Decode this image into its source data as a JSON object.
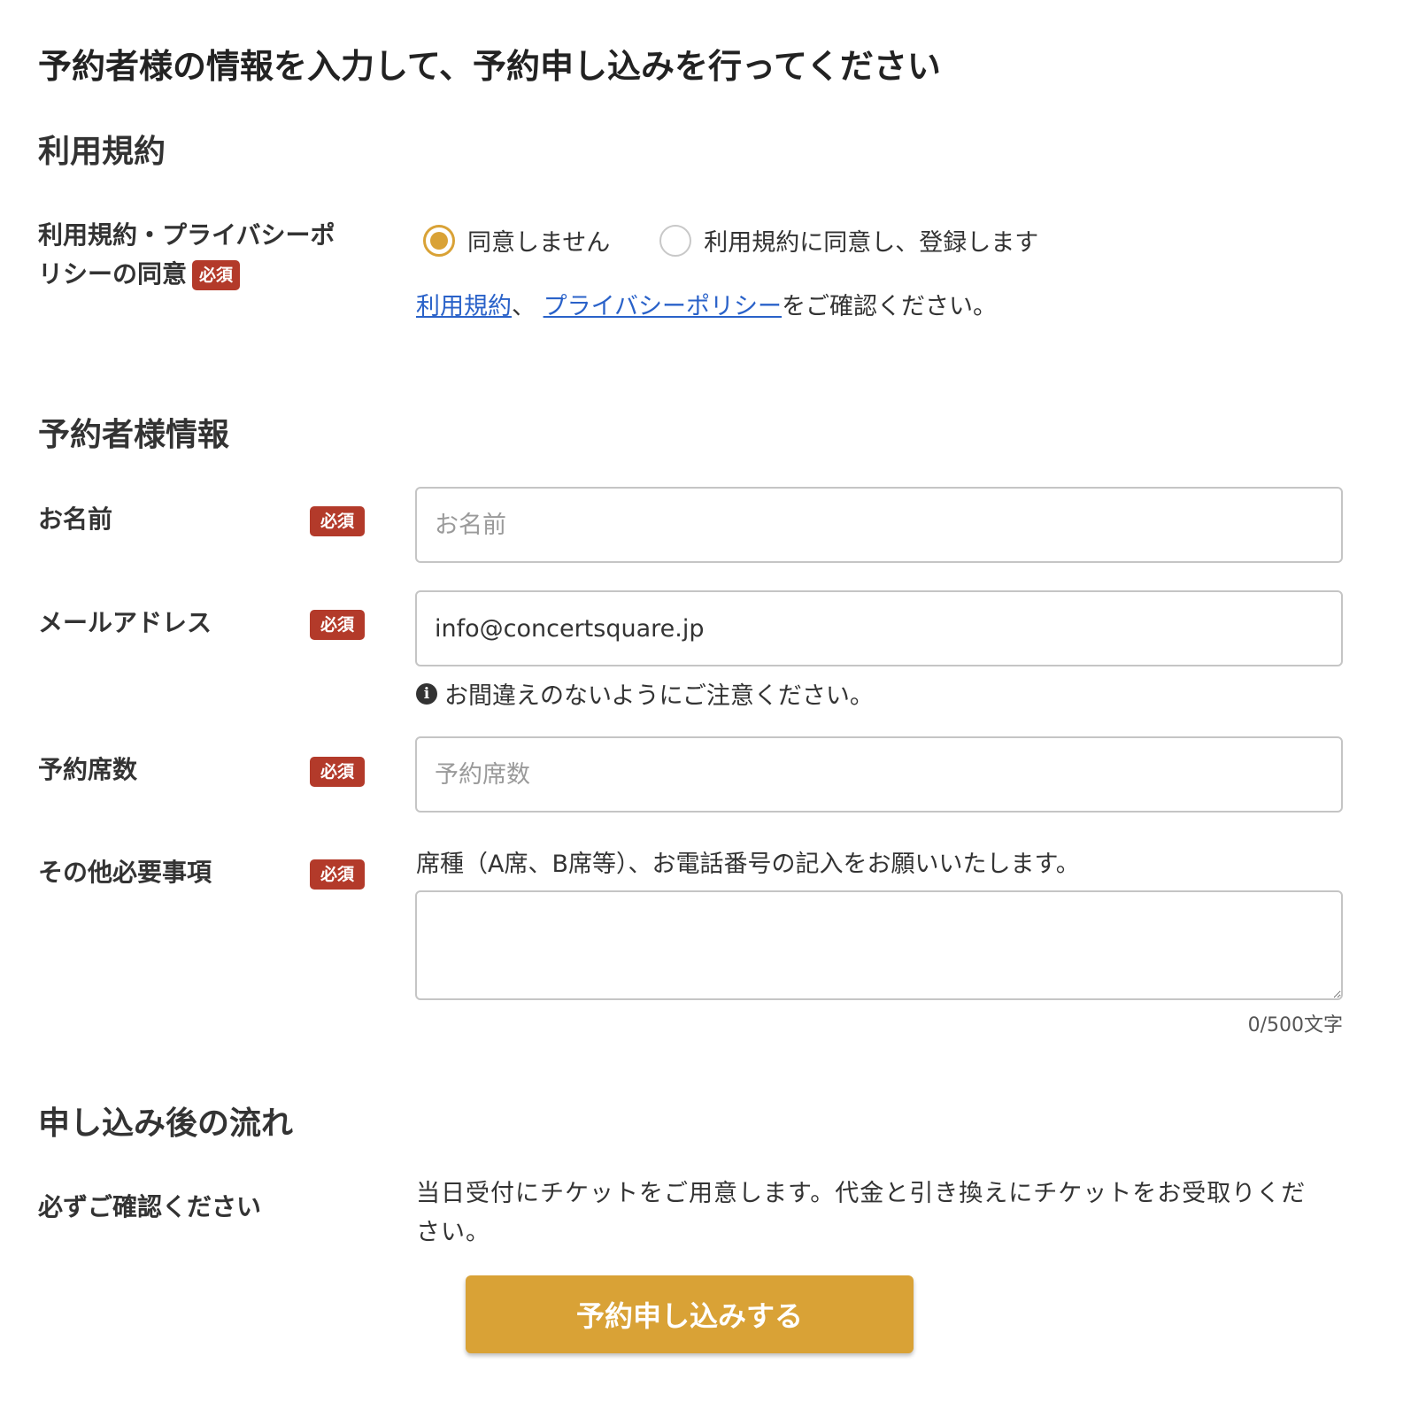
{
  "page": {
    "title": "予約者様の情報を入力して、予約申し込みを行ってください"
  },
  "terms": {
    "section_title": "利用規約",
    "label": "利用規約・プライバシーポリシーの同意",
    "required": "必須",
    "options": [
      {
        "label": "同意しません",
        "selected": true
      },
      {
        "label": "利用規約に同意し、登録します",
        "selected": false
      }
    ],
    "note_link_terms": "利用規約",
    "note_sep": "、 ",
    "note_link_privacy": "プライバシーポリシー",
    "note_suffix": "をご確認ください。"
  },
  "booker": {
    "section_title": "予約者様情報",
    "name": {
      "label": "お名前",
      "required": "必須",
      "placeholder": "お名前",
      "value": ""
    },
    "email": {
      "label": "メールアドレス",
      "required": "必須",
      "value": "info@concertsquare.jp",
      "hint": "お間違えのないようにご注意ください。"
    },
    "seats": {
      "label": "予約席数",
      "required": "必須",
      "placeholder": "予約席数",
      "value": ""
    },
    "other": {
      "label": "その他必要事項",
      "required": "必須",
      "instruction": "席種（A席、B席等）、お電話番号の記入をお願いいたします。",
      "value": "",
      "char_count": "0/500文字"
    }
  },
  "flow": {
    "section_title": "申し込み後の流れ",
    "label": "必ずご確認ください",
    "text": "当日受付にチケットをご用意します。代金と引き換えにチケットをお受取りください。"
  },
  "submit": {
    "label": "予約申し込みする"
  },
  "colors": {
    "accent": "#d9a236",
    "required_badge": "#b33a2a",
    "link": "#2a62c9"
  },
  "icons": {
    "hint": "info-icon"
  }
}
